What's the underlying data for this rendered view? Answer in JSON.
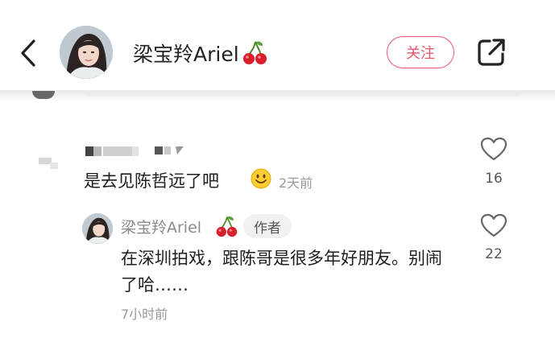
{
  "header": {
    "author_name": "梁宝羚Ariel",
    "follow_label": "关注",
    "icons": {
      "back": "chevron-left-icon",
      "share": "share-icon",
      "name_emoji": "cherry-icon"
    },
    "accent_color": "#e8566b"
  },
  "comment": {
    "text": "是去见陈哲远了吧",
    "emoji": "smiley-emoji",
    "time": "2天前",
    "like_count": "16"
  },
  "reply": {
    "author_name": "梁宝羚Ariel",
    "badge": "作者",
    "text": "在深圳拍戏，跟陈哥是很多年好朋友。别闹了哈……",
    "time": "7小时前",
    "like_count": "22"
  }
}
